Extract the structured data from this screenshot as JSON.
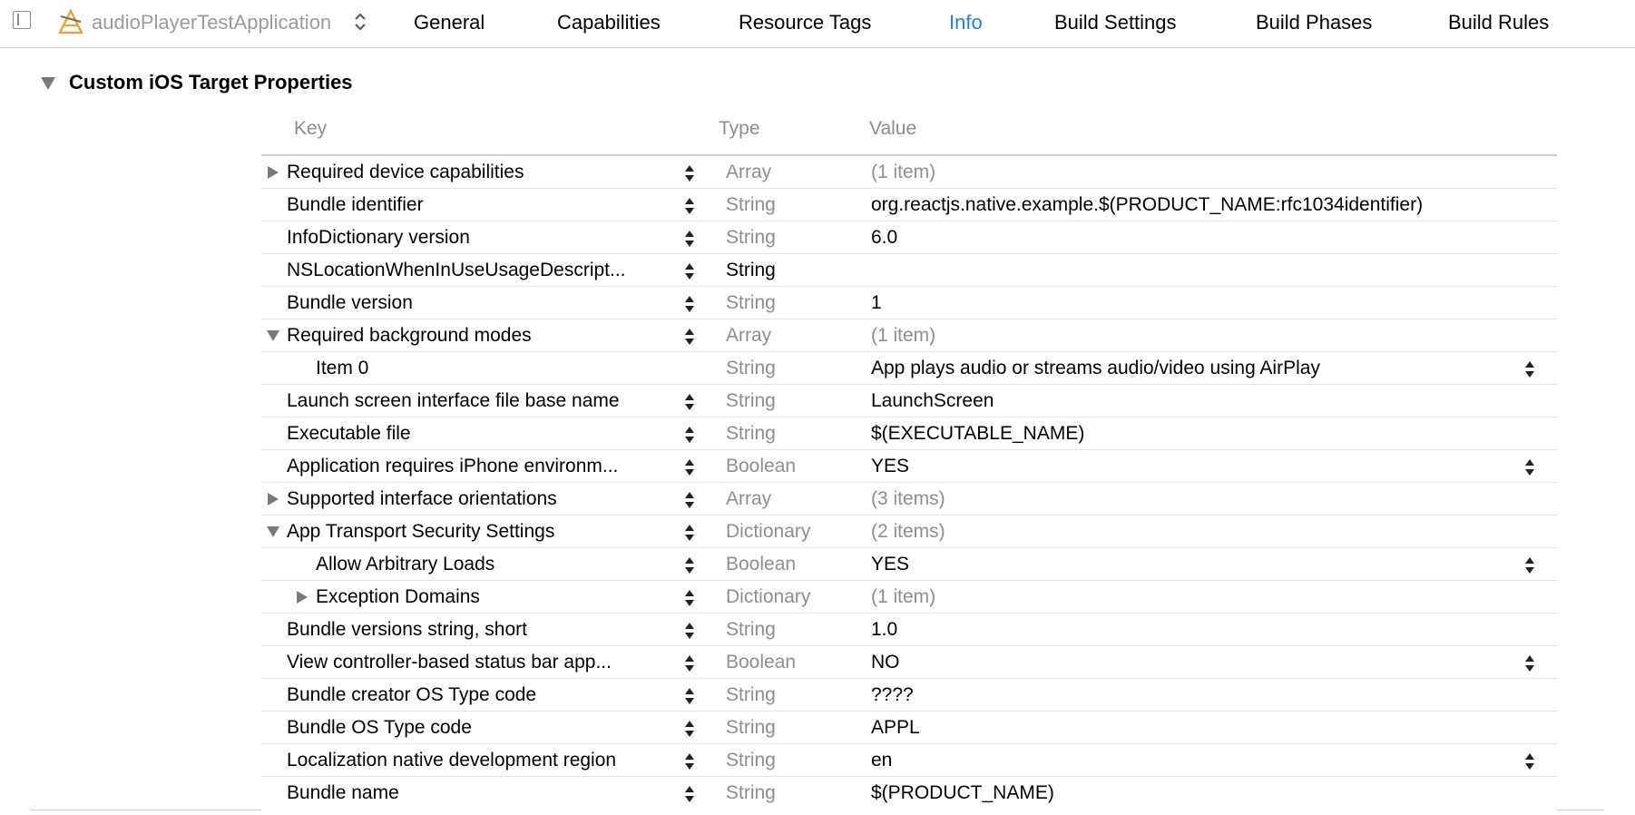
{
  "topbar": {
    "target_name": "audioPlayerTestApplication",
    "tabs": [
      {
        "label": "General",
        "active": false
      },
      {
        "label": "Capabilities",
        "active": false
      },
      {
        "label": "Resource Tags",
        "active": false
      },
      {
        "label": "Info",
        "active": true
      },
      {
        "label": "Build Settings",
        "active": false
      },
      {
        "label": "Build Phases",
        "active": false
      },
      {
        "label": "Build Rules",
        "active": false
      }
    ],
    "icons": [
      "sidebar-toggle-icon",
      "target-app-icon",
      "up-down-chevron-icon"
    ]
  },
  "section": {
    "title": "Custom iOS Target Properties",
    "expanded": true
  },
  "table": {
    "headers": {
      "key": "Key",
      "type": "Type",
      "value": "Value"
    },
    "rows": [
      {
        "key": "Required device capabilities",
        "type": "Array",
        "value": "(1 item)",
        "indent": 0,
        "disclosure": "collapsed",
        "value_muted": true,
        "value_stepper": false,
        "key_stepper": true
      },
      {
        "key": "Bundle identifier",
        "type": "String",
        "value": "org.reactjs.native.example.$(PRODUCT_NAME:rfc1034identifier)",
        "indent": 0,
        "disclosure": "none",
        "value_muted": false,
        "value_stepper": false,
        "key_stepper": true
      },
      {
        "key": "InfoDictionary version",
        "type": "String",
        "value": "6.0",
        "indent": 0,
        "disclosure": "none",
        "value_muted": false,
        "value_stepper": false,
        "key_stepper": true
      },
      {
        "key": "NSLocationWhenInUseUsageDescript...",
        "type": "String",
        "value": "",
        "indent": 0,
        "disclosure": "none",
        "value_muted": false,
        "value_stepper": false,
        "key_stepper": true,
        "type_editing": true
      },
      {
        "key": "Bundle version",
        "type": "String",
        "value": "1",
        "indent": 0,
        "disclosure": "none",
        "value_muted": false,
        "value_stepper": false,
        "key_stepper": true
      },
      {
        "key": "Required background modes",
        "type": "Array",
        "value": "(1 item)",
        "indent": 0,
        "disclosure": "expanded",
        "value_muted": true,
        "value_stepper": false,
        "key_stepper": true
      },
      {
        "key": "Item 0",
        "type": "String",
        "value": "App plays audio or streams audio/video using AirPlay",
        "indent": 1,
        "disclosure": "none",
        "value_muted": false,
        "value_stepper": true,
        "key_stepper": false
      },
      {
        "key": "Launch screen interface file base name",
        "type": "String",
        "value": "LaunchScreen",
        "indent": 0,
        "disclosure": "none",
        "value_muted": false,
        "value_stepper": false,
        "key_stepper": true
      },
      {
        "key": "Executable file",
        "type": "String",
        "value": "$(EXECUTABLE_NAME)",
        "indent": 0,
        "disclosure": "none",
        "value_muted": false,
        "value_stepper": false,
        "key_stepper": true
      },
      {
        "key": "Application requires iPhone environm...",
        "type": "Boolean",
        "value": "YES",
        "indent": 0,
        "disclosure": "none",
        "value_muted": false,
        "value_stepper": true,
        "key_stepper": true
      },
      {
        "key": "Supported interface orientations",
        "type": "Array",
        "value": "(3 items)",
        "indent": 0,
        "disclosure": "collapsed",
        "value_muted": true,
        "value_stepper": false,
        "key_stepper": true
      },
      {
        "key": "App Transport Security Settings",
        "type": "Dictionary",
        "value": "(2 items)",
        "indent": 0,
        "disclosure": "expanded",
        "value_muted": true,
        "value_stepper": false,
        "key_stepper": true
      },
      {
        "key": "Allow Arbitrary Loads",
        "type": "Boolean",
        "value": "YES",
        "indent": 1,
        "disclosure": "none",
        "value_muted": false,
        "value_stepper": true,
        "key_stepper": true
      },
      {
        "key": "Exception Domains",
        "type": "Dictionary",
        "value": "(1 item)",
        "indent": 1,
        "disclosure": "collapsed",
        "value_muted": true,
        "value_stepper": false,
        "key_stepper": true
      },
      {
        "key": "Bundle versions string, short",
        "type": "String",
        "value": "1.0",
        "indent": 0,
        "disclosure": "none",
        "value_muted": false,
        "value_stepper": false,
        "key_stepper": true
      },
      {
        "key": "View controller-based status bar app...",
        "type": "Boolean",
        "value": "NO",
        "indent": 0,
        "disclosure": "none",
        "value_muted": false,
        "value_stepper": true,
        "key_stepper": true
      },
      {
        "key": "Bundle creator OS Type code",
        "type": "String",
        "value": "????",
        "indent": 0,
        "disclosure": "none",
        "value_muted": false,
        "value_stepper": false,
        "key_stepper": true
      },
      {
        "key": "Bundle OS Type code",
        "type": "String",
        "value": "APPL",
        "indent": 0,
        "disclosure": "none",
        "value_muted": false,
        "value_stepper": false,
        "key_stepper": true
      },
      {
        "key": "Localization native development region",
        "type": "String",
        "value": "en",
        "indent": 0,
        "disclosure": "none",
        "value_muted": false,
        "value_stepper": true,
        "key_stepper": true
      },
      {
        "key": "Bundle name",
        "type": "String",
        "value": "$(PRODUCT_NAME)",
        "indent": 0,
        "disclosure": "none",
        "value_muted": false,
        "value_stepper": false,
        "key_stepper": true
      }
    ]
  },
  "colors": {
    "accent": "#1e7fe8",
    "muted_text": "#8e8e8e",
    "row_divider": "#e4e4e4",
    "disclosure": "#7a7a7a"
  }
}
